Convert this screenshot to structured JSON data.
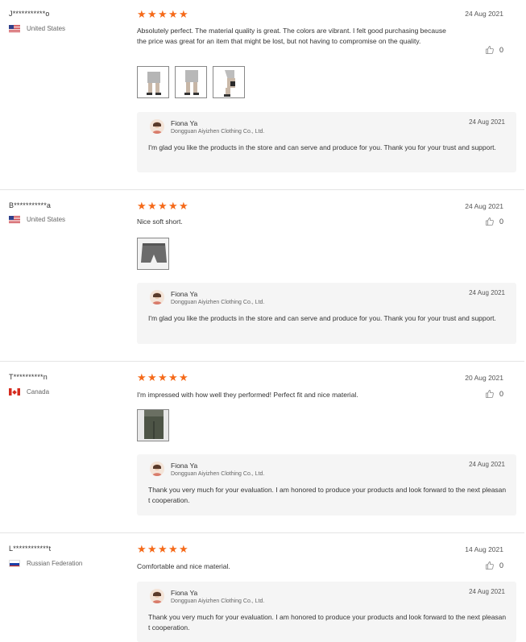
{
  "reviews": [
    {
      "user": "J***********o",
      "country": "United States",
      "flag": "us",
      "stars": 5,
      "date": "24 Aug 2021",
      "text": "Absolutely perfect.  The material quality is great. The colors are vibrant.  I felt good purchasing because the price was great for an item that might be lost, but not having to compromise on the quality.",
      "likes": "0",
      "photos": [
        "shorts-photo-front",
        "shorts-photo-back",
        "shorts-photo-side"
      ],
      "reply": {
        "name": "Fiona Ya",
        "company": "Dongguan Aiyizhen Clothing Co., Ltd.",
        "date": "24 Aug 2021",
        "text": "I'm glad you like the products in the store and can serve and produce for you. Thank you for your trust and support."
      }
    },
    {
      "user": "B***********a",
      "country": "United States",
      "flag": "us",
      "stars": 5,
      "date": "24 Aug 2021",
      "text": "Nice soft short.",
      "likes": "0",
      "photos": [
        "shorts-photo-flat"
      ],
      "reply": {
        "name": "Fiona Ya",
        "company": "Dongguan Aiyizhen Clothing Co., Ltd.",
        "date": "24 Aug 2021",
        "text": "I'm glad you like the products in the store and can serve and produce for you. Thank you for your trust and support."
      }
    },
    {
      "user": "T**********n",
      "country": "Canada",
      "flag": "ca",
      "stars": 5,
      "date": "20 Aug 2021",
      "text": "I'm impressed with how well they performed! Perfect fit and nice material.",
      "likes": "0",
      "photos": [
        "shorts-photo-worn"
      ],
      "reply": {
        "name": "Fiona Ya",
        "company": "Dongguan Aiyizhen Clothing Co., Ltd.",
        "date": "24 Aug 2021",
        "text": "Thank you very much for your evaluation. I am honored to produce your products and look forward to the next pleasant cooperation."
      }
    },
    {
      "user": "L************t",
      "country": "Russian Federation",
      "flag": "ru",
      "stars": 5,
      "date": "14 Aug 2021",
      "text": "Comfortable and nice material.",
      "likes": "0",
      "photos": [],
      "reply": {
        "name": "Fiona Ya",
        "company": "Dongguan Aiyizhen Clothing Co., Ltd.",
        "date": "24 Aug 2021",
        "text": "Thank you very much for your evaluation. I am honored to produce your products and look forward to the next pleasant cooperation."
      }
    }
  ],
  "colors": {
    "star": "#f56a1a",
    "reply_bg": "#f5f5f5",
    "divider": "#e4e4e4"
  },
  "icons": {
    "star": "star-icon",
    "thumb": "thumbs-up-icon"
  }
}
